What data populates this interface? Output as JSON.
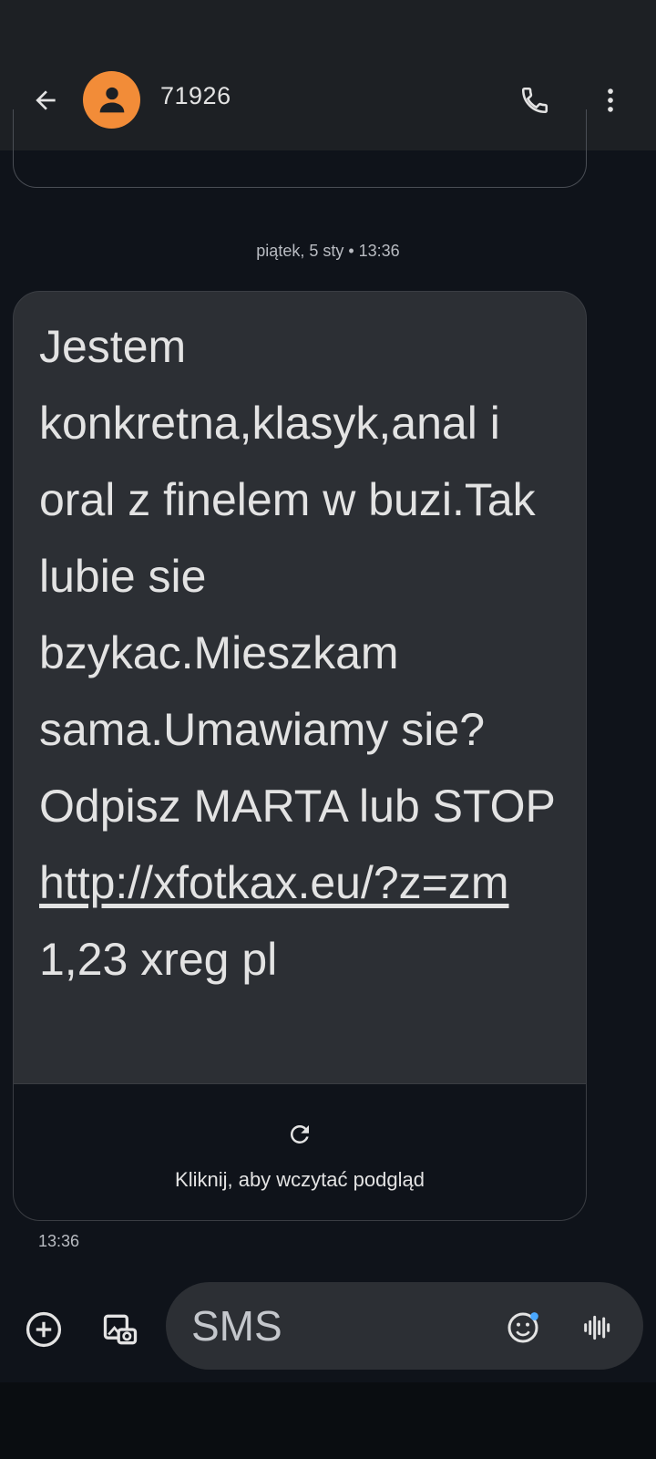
{
  "header": {
    "contact_name": "71926",
    "back_icon": "arrow-left-icon",
    "avatar_icon": "person-icon",
    "call_icon": "phone-icon",
    "more_icon": "more-vert-icon",
    "avatar_color": "#f28c38"
  },
  "conversation": {
    "date_separator": "piątek, 5 sty • 13:36",
    "message": {
      "text_before_link": "Jestem konkretna,klasyk,anal i oral z finelem w buzi.Tak lubie sie bzykac.Mieszkam sama.Umawiamy sie? Odpisz MARTA lub STOP ",
      "link": "http://xfotkax.eu/?z=zm",
      "text_after_link": " 1,23 xreg pl",
      "preview_label": "Kliknij, aby wczytać podgląd",
      "preview_icon": "refresh-icon",
      "time": "13:36"
    }
  },
  "compose": {
    "placeholder": "SMS",
    "add_icon": "add-circle-icon",
    "gallery_icon": "gallery-icon",
    "emoji_icon": "emoji-icon",
    "voice_icon": "voice-waveform-icon"
  }
}
